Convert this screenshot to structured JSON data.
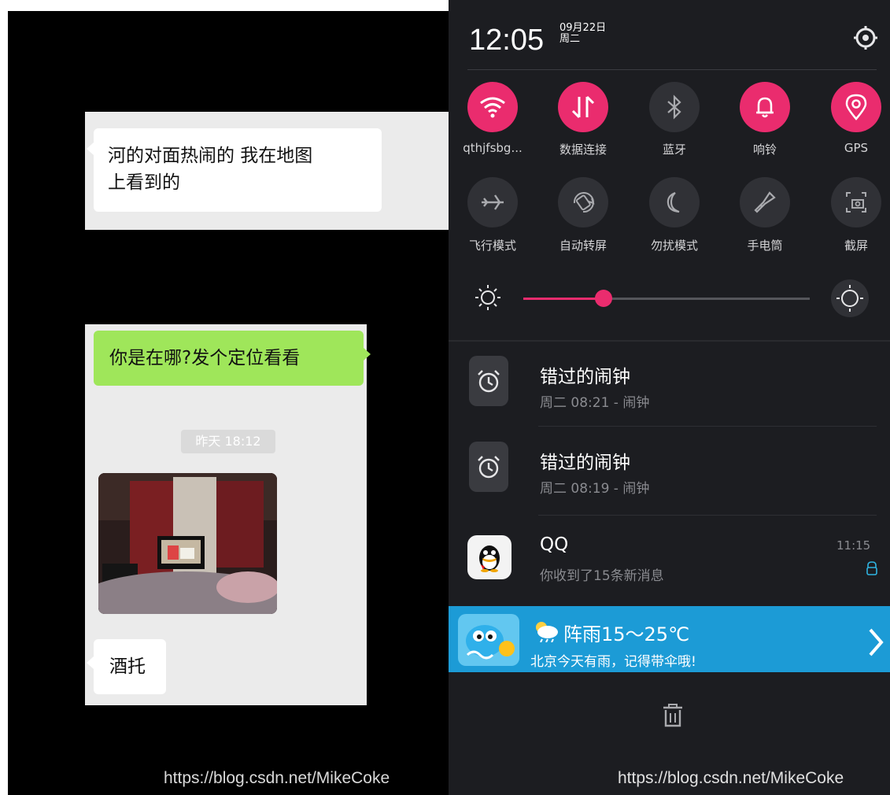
{
  "left": {
    "msg1": "河的对面热闹的 我在地图",
    "msg1_line2": "上看到的",
    "msg2": "你是在哪?发个定位看看",
    "time": "昨天 18:12",
    "msg3": "酒托",
    "watermark": "https://blog.csdn.net/MikeCoke"
  },
  "right": {
    "time": "12:05",
    "date": "09月22日",
    "weekday": "周二",
    "settings_icon": "gear-icon",
    "quick_settings": [
      {
        "label": "qthjfsbg...",
        "icon": "wifi-icon",
        "active": true
      },
      {
        "label": "数据连接",
        "icon": "data-icon",
        "active": true
      },
      {
        "label": "蓝牙",
        "icon": "bluetooth-icon",
        "active": false
      },
      {
        "label": "响铃",
        "icon": "bell-icon",
        "active": true
      },
      {
        "label": "GPS",
        "icon": "location-icon",
        "active": true
      },
      {
        "label": "飞行模式",
        "icon": "airplane-icon",
        "active": false
      },
      {
        "label": "自动转屏",
        "icon": "rotate-icon",
        "active": false
      },
      {
        "label": "勿扰模式",
        "icon": "moon-icon",
        "active": false
      },
      {
        "label": "手电筒",
        "icon": "flashlight-icon",
        "active": false
      },
      {
        "label": "截屏",
        "icon": "screenshot-icon",
        "active": false
      }
    ],
    "brightness_level": 0.28,
    "notifications": [
      {
        "title": "错过的闹钟",
        "subtitle": "周二 08:21 - 闹钟",
        "icon": "alarm-icon"
      },
      {
        "title": "错过的闹钟",
        "subtitle": "周二 08:19 - 闹钟",
        "icon": "alarm-icon"
      },
      {
        "title": "QQ",
        "subtitle": "你收到了15条新消息",
        "time": "11:15",
        "icon": "qq-icon"
      }
    ],
    "weather": {
      "title": "阵雨15～25℃",
      "subtitle": "北京今天有雨，记得带伞哦!",
      "icon": "weather-icon"
    },
    "watermark": "https://blog.csdn.net/MikeCoke",
    "colors": {
      "accent": "#ea2c6e",
      "panel": "#1c1d21",
      "weather": "#1c9bd6"
    }
  }
}
